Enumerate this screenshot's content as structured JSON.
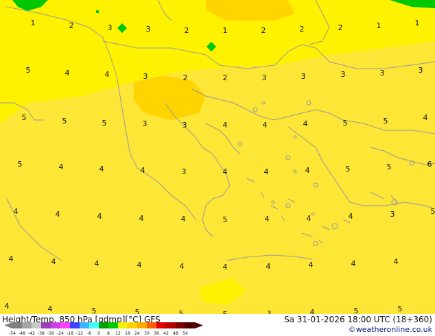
{
  "map": {
    "colors": {
      "sea_yellow": "#fff200",
      "warm_yellow": "#fde636",
      "orange_patch": "#ffd400",
      "green": "#00c800",
      "coast": "#9a9a9a"
    },
    "values": [
      "1",
      "2",
      "3",
      "3",
      "2",
      "1",
      "2",
      "2",
      "2",
      "1",
      "1",
      "5",
      "4",
      "4",
      "3",
      "2",
      "2",
      "3",
      "3",
      "3",
      "3",
      "3",
      "5",
      "5",
      "5",
      "3",
      "3",
      "4",
      "4",
      "4",
      "5",
      "5",
      "4",
      "5",
      "4",
      "4",
      "4",
      "3",
      "4",
      "4",
      "4",
      "5",
      "5",
      "6",
      "4",
      "4",
      "4",
      "4",
      "4",
      "5",
      "4",
      "4",
      "4",
      "3",
      "5",
      "4",
      "4",
      "4",
      "4",
      "4",
      "4",
      "4",
      "4",
      "4",
      "4",
      "4",
      "4",
      "5",
      "5",
      "5",
      "5",
      "3",
      "4",
      "5",
      "5"
    ]
  },
  "footer": {
    "title": "Height/Temp. 850 hPa [gdmp][°C] GFS",
    "datetime": "Sa 31-01-2026 18:00 UTC (18+360)",
    "credit": "©weatheronline.co.uk"
  },
  "colorbar": {
    "ticks": [
      "-54",
      "-48",
      "-42",
      "-38",
      "-30",
      "-24",
      "-18",
      "-12",
      "-8",
      "0",
      "8",
      "12",
      "18",
      "24",
      "30",
      "38",
      "42",
      "48",
      "54"
    ],
    "colors": [
      "#7f7f7f",
      "#a5a5a5",
      "#c8c8c8",
      "#9d3fb9",
      "#d23fe6",
      "#ff41ff",
      "#3f3fff",
      "#3fb3ff",
      "#41ffff",
      "#00a000",
      "#00c800",
      "#f0f000",
      "#ffd400",
      "#ffaa00",
      "#ff5f00",
      "#e00000",
      "#b40000",
      "#780000",
      "#500000"
    ]
  }
}
